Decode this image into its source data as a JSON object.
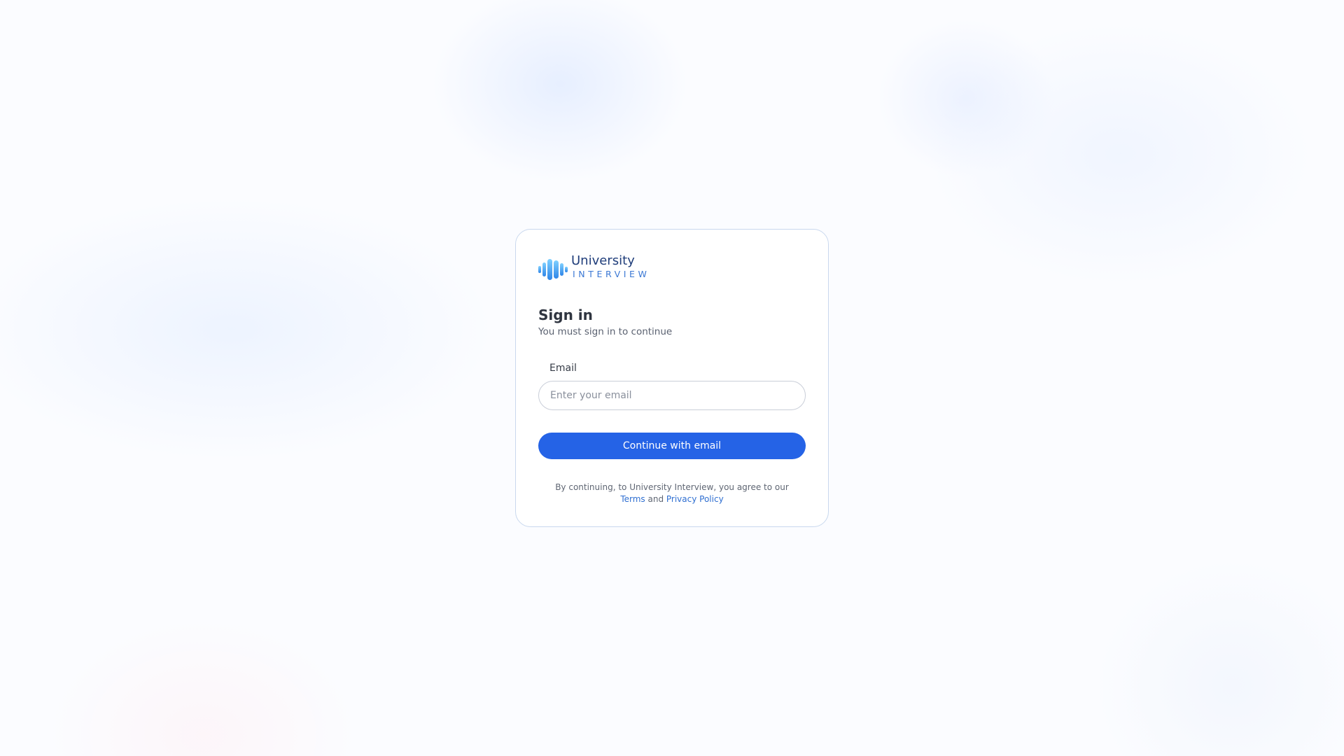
{
  "brand": {
    "name": "University",
    "tagline": "INTERVIEW",
    "logo_icon": "waveform-logo-icon"
  },
  "signin": {
    "title": "Sign in",
    "subtitle": "You must sign in to continue",
    "email_label": "Email",
    "email_placeholder": "Enter your email",
    "email_value": "",
    "continue_label": "Continue with email"
  },
  "legal": {
    "prefix": "By continuing, to University Interview, you agree to our",
    "terms_label": "Terms",
    "conjunction": "and",
    "privacy_label": "Privacy Policy"
  },
  "colors": {
    "primary": "#2563e6",
    "link": "#2f6fd1",
    "card_border": "#c9d8ee",
    "brand_text": "#1f3d7a"
  }
}
